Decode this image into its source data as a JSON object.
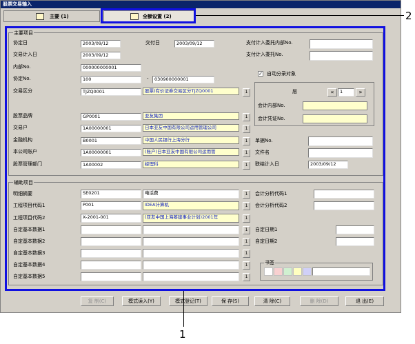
{
  "window": {
    "title": "股票交易输入"
  },
  "tabs": {
    "main": "主要 (1)",
    "all_settings": "全额设置 (2)"
  },
  "callouts": {
    "one": "1",
    "two": "2"
  },
  "main_group": {
    "title": "主要项目",
    "agreement_date_label": "协定日",
    "agreement_date": "2003/09/12",
    "delivery_date_label": "交付日",
    "delivery_date": "2003/09/12",
    "pay_dept_label": "支付计入委托内部No.",
    "trade_date_label": "交易计入日",
    "trade_date": "2003/09/12",
    "pay_no_label": "支付计入委托No.",
    "internal_no_label": "内部No.",
    "internal_no": "000000000001",
    "agreement_no_label": "协定No.",
    "agreement_no": "100",
    "dash": "-",
    "agreement_no2": "030900000001",
    "auto_split_label": "自动分录对象",
    "auto_split_checked": "✓",
    "trade_type_label": "交易区分",
    "trade_type_code": "TJZQ0001",
    "trade_type_name": "股票)有价证券交易区分TJZQ0001",
    "layer_label": "层",
    "layer_value": "1",
    "nav_prev": "«",
    "nav_next": "»",
    "acct_internal_label": "会计内部No.",
    "acct_voucher_label": "会计凭证No.",
    "brand_label": "股票品牌",
    "brand_code": "GP0001",
    "brand_name": "亚友集团",
    "customer_label": "交易户",
    "customer_code": "1A00000001",
    "customer_name": "日本亚友中国有限公司运用管理公司",
    "bank_label": "金融机构",
    "bank_code": "B0001",
    "bank_name": "中国人民银行上海分行",
    "voucher_label": "单据No.",
    "own_account_label": "本公司账户",
    "own_account_code": "1A00000001",
    "own_account_name": "(账户)日本亚友中国有限公司运用管",
    "doc_name_label": "文件名",
    "dept_label": "股票管理部门",
    "dept_code": "1A00002",
    "dept_name": "经理科",
    "link_date_label": "联结计入日",
    "link_date": "2003/09/12",
    "select_label": "1"
  },
  "aux_group": {
    "title": "辅助项目",
    "detail_label": "明细摘要",
    "detail_code": "SE0201",
    "detail_name": "电话费",
    "project1_label": "工程项目代码1",
    "project1_code": "P001",
    "project1_name": "IDEA计算机",
    "project2_label": "工程项目代码2",
    "project2_code": "X-2001-001",
    "project2_name": "(亚友中国上海筹建事业计划)2001年",
    "custom1_label": "自定基本数据1",
    "custom2_label": "自定基本数据2",
    "custom3_label": "自定基本数据3",
    "custom4_label": "自定基本数据4",
    "custom5_label": "自定基本数据5",
    "analysis1_label": "会计分析代码1",
    "analysis2_label": "会计分析代码2",
    "custom_date1_label": "自定日期1",
    "custom_date2_label": "自定日期2",
    "bookmark_label": "书签",
    "bookmark_colors": [
      "#ffffff",
      "#f8d0d0",
      "#d0f0d0",
      "#ffffc0",
      "#d0d0f8"
    ]
  },
  "buttons": {
    "copy": "复 制(C)",
    "template_read": "模式读入(Y)",
    "template_register": "模式登记(T)",
    "save": "保 存(S)",
    "clear": "清 除(C)",
    "delete": "删 除(D)",
    "exit": "退 出(E)"
  }
}
